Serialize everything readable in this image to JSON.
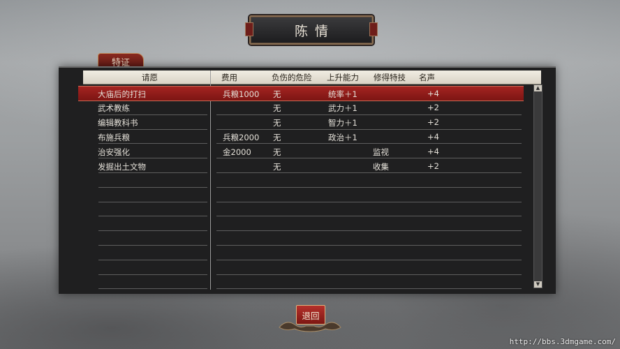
{
  "title": "陈情",
  "tab_label": "特证",
  "columns": {
    "request": "请愿",
    "cost": "费用",
    "risk": "负伤的危险",
    "ability": "上升能力",
    "skill": "修得特技",
    "fame": "名声"
  },
  "rows": [
    {
      "request": "大庙后的打扫",
      "cost": "兵粮1000",
      "risk": "无",
      "ability": "统率＋1",
      "skill": "",
      "fame": "+4",
      "selected": true
    },
    {
      "request": "武术教练",
      "cost": "",
      "risk": "无",
      "ability": "武力＋1",
      "skill": "",
      "fame": "+2",
      "selected": false
    },
    {
      "request": "编辑教科书",
      "cost": "",
      "risk": "无",
      "ability": "智力＋1",
      "skill": "",
      "fame": "+2",
      "selected": false
    },
    {
      "request": "布施兵粮",
      "cost": "兵粮2000",
      "risk": "无",
      "ability": "政治＋1",
      "skill": "",
      "fame": "+4",
      "selected": false
    },
    {
      "request": "治安强化",
      "cost": "金2000",
      "risk": "无",
      "ability": "",
      "skill": "监视",
      "fame": "+4",
      "selected": false
    },
    {
      "request": "发掘出土文物",
      "cost": "",
      "risk": "无",
      "ability": "",
      "skill": "收集",
      "fame": "+2",
      "selected": false
    }
  ],
  "return_label": "退回",
  "watermark": "http://bbs.3dmgame.com/",
  "colors": {
    "selected_row": "#a42421",
    "header_bg": "#f1ede3",
    "panel_bg": "#1f1f20"
  },
  "icons": {
    "scroll_up": "triangle-up-icon",
    "scroll_down": "triangle-down-icon"
  }
}
